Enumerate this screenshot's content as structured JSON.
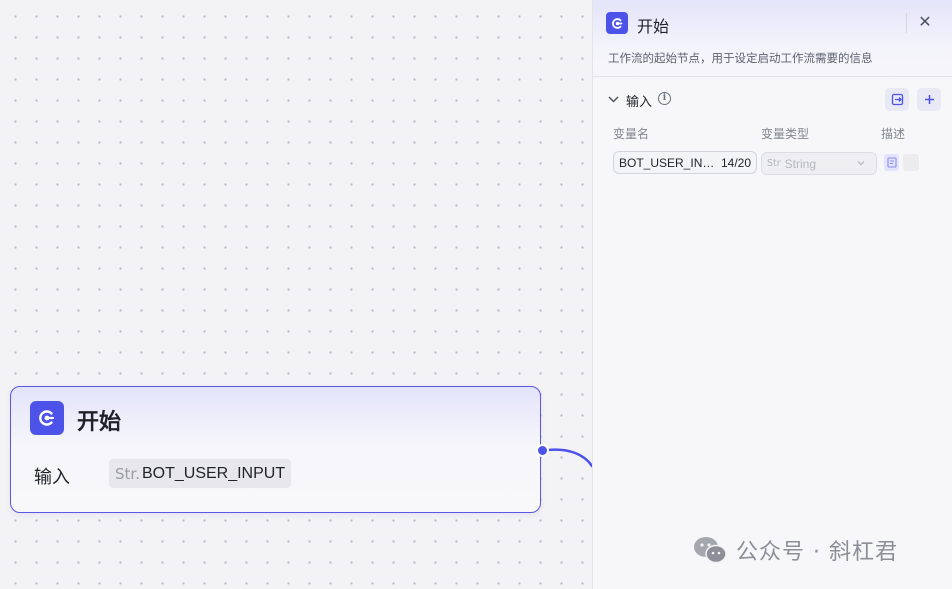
{
  "node": {
    "title": "开始",
    "input_label": "输入",
    "input_type": "Str.",
    "input_name": "BOT_USER_INPUT"
  },
  "panel": {
    "title": "开始",
    "description": "工作流的起始节点，用于设定启动工作流需要的信息",
    "close_symbol": "✕",
    "section": {
      "title": "输入",
      "info_symbol": "i"
    },
    "columns": {
      "name": "变量名",
      "type": "变量类型",
      "desc": "描述"
    },
    "row": {
      "name_value": "BOT_USER_IN…",
      "name_count": "14/20",
      "type_badge": "Str",
      "type_value": "String"
    }
  },
  "watermark": {
    "text": "公众号 · 斜杠君"
  },
  "colors": {
    "accent": "#4d53e8",
    "node_border": "#5b57e6"
  },
  "icons": [
    "workflow-start-icon",
    "close-icon",
    "chevron-down-icon",
    "info-icon",
    "export-icon",
    "plus-icon",
    "note-icon",
    "wechat-icon"
  ]
}
